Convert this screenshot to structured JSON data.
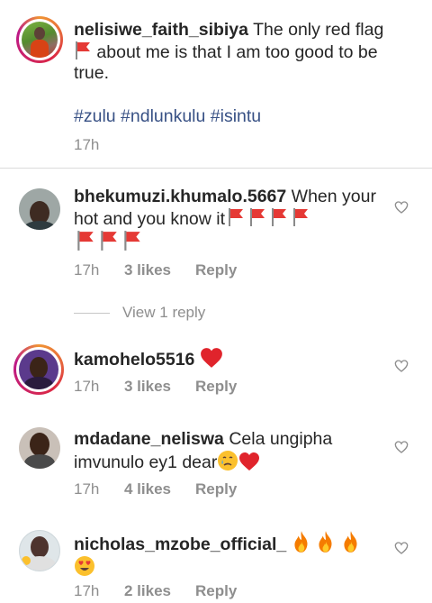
{
  "caption": {
    "username": "nelisiwe_faith_sibiya",
    "text_before_flag": " The only red flag",
    "text_after_flag": " about me is that I am too good to be true.",
    "hashtags": "#zulu #ndlunkulu #isintu",
    "time": "17h"
  },
  "comments": [
    {
      "username": "bhekumuzi.khumalo.5667",
      "text": " When your hot and you know it",
      "emoji": [
        "red-flag",
        "red-flag",
        "red-flag",
        "red-flag",
        "red-flag",
        "red-flag",
        "red-flag"
      ],
      "time": "17h",
      "likes": "3 likes",
      "reply": "Reply",
      "view_replies": "View 1 reply"
    },
    {
      "username": "kamohelo5516",
      "text": "",
      "emoji": [
        "red-heart"
      ],
      "time": "17h",
      "likes": "3 likes",
      "reply": "Reply"
    },
    {
      "username": "mdadane_neliswa",
      "text": " Cela ungipha imvunulo ey1 dear",
      "emoji": [
        "crying-face",
        "red-heart"
      ],
      "time": "17h",
      "likes": "4 likes",
      "reply": "Reply"
    },
    {
      "username": "nicholas_mzobe_official_",
      "text": "",
      "emoji": [
        "fire",
        "fire",
        "fire",
        "heart-eyes-face"
      ],
      "time": "17h",
      "likes": "2 likes",
      "reply": "Reply"
    }
  ],
  "colors": {
    "text": "#262626",
    "muted": "#8e8e8e",
    "hashtag": "#385185",
    "divider": "#dbdbdb"
  }
}
